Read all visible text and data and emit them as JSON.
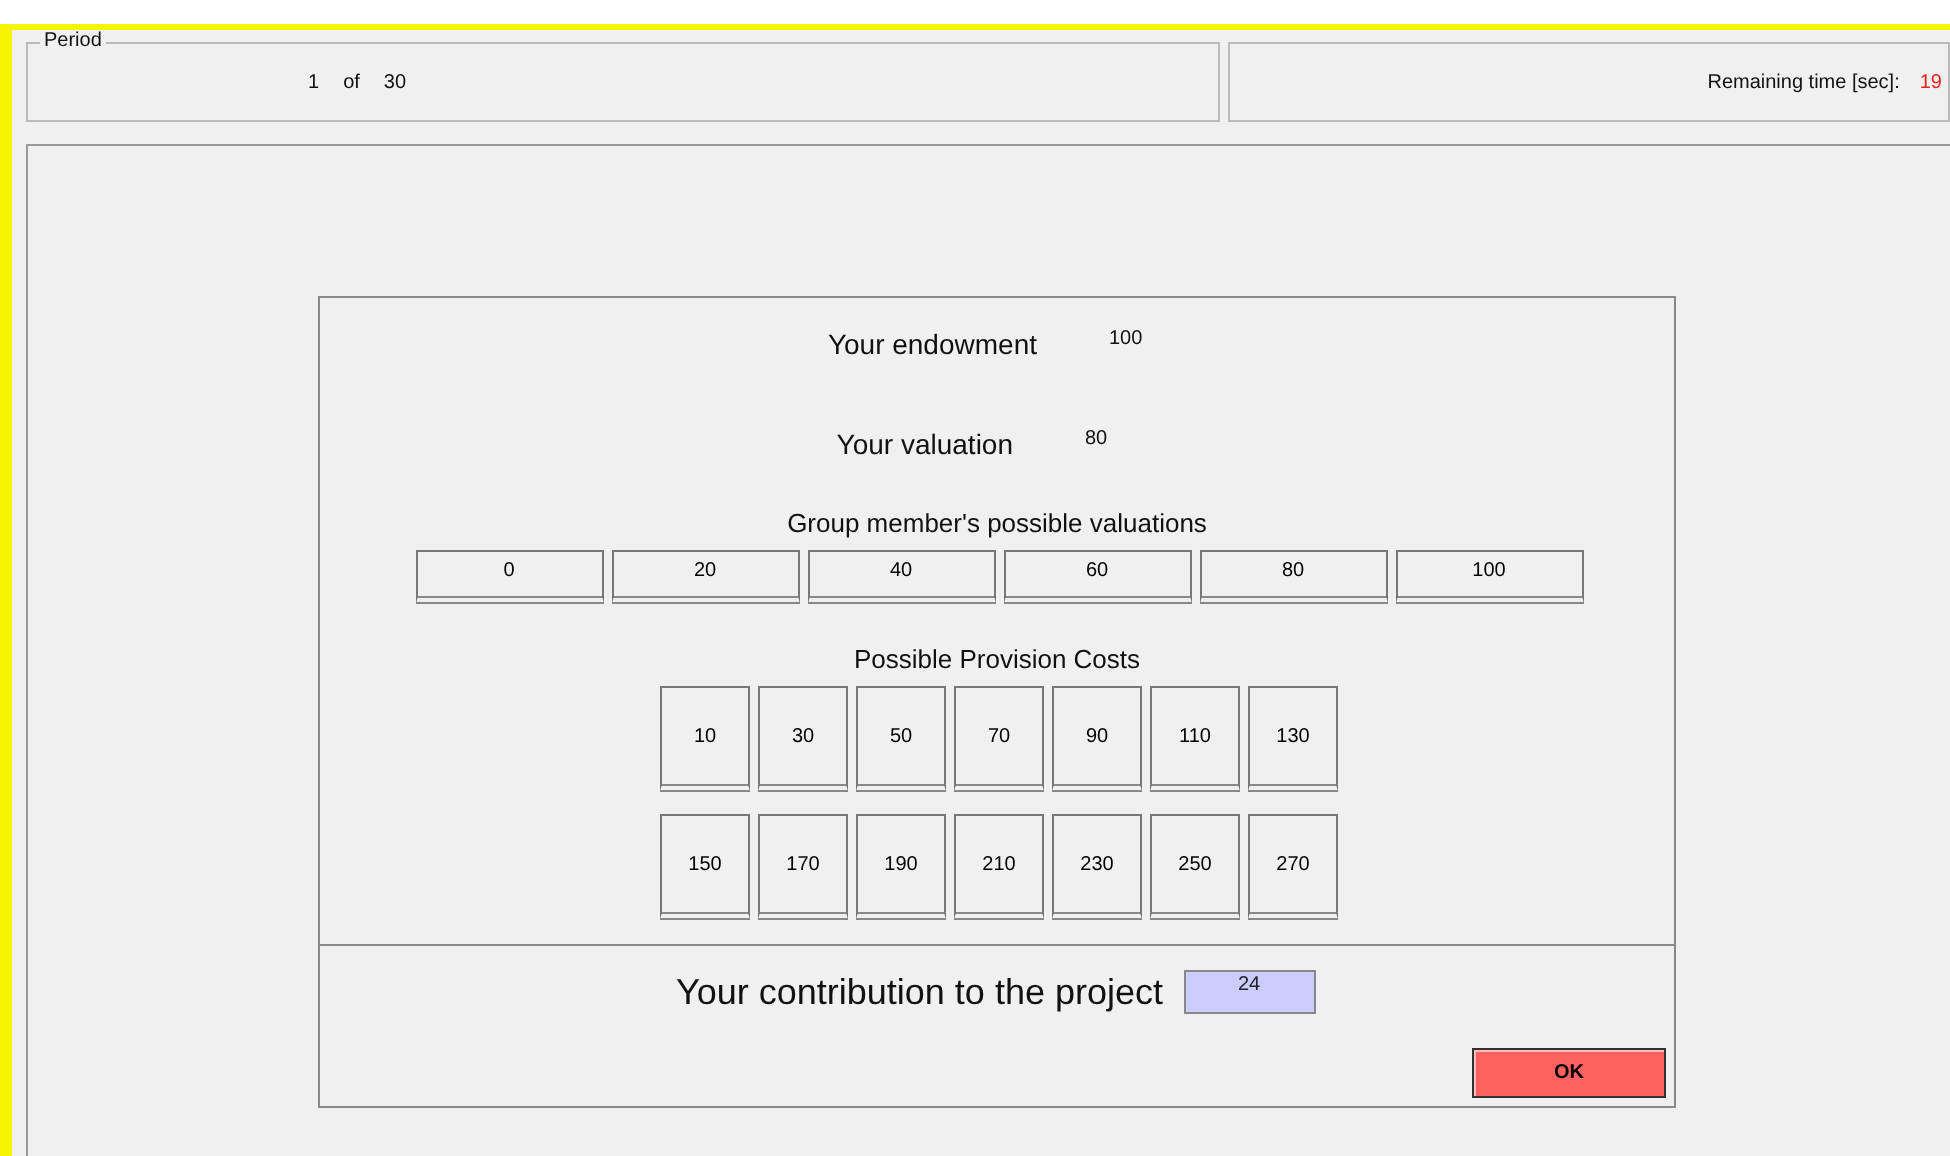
{
  "period": {
    "legend": "Period",
    "current": "1",
    "of": "of",
    "total": "30"
  },
  "timer": {
    "label": "Remaining time [sec]:",
    "value": "19"
  },
  "endowment": {
    "label": "Your endowment",
    "value": "100"
  },
  "valuation": {
    "label": "Your valuation",
    "value": "80"
  },
  "group_valuations": {
    "title": "Group member's possible valuations",
    "options": [
      "0",
      "20",
      "40",
      "60",
      "80",
      "100"
    ]
  },
  "provision_costs": {
    "title": "Possible Provision Costs",
    "rows": [
      [
        "10",
        "30",
        "50",
        "70",
        "90",
        "110",
        "130"
      ],
      [
        "150",
        "170",
        "190",
        "210",
        "230",
        "250",
        "270"
      ]
    ]
  },
  "contribution": {
    "label": "Your contribution to the project",
    "value": "24"
  },
  "ok_button": "OK"
}
